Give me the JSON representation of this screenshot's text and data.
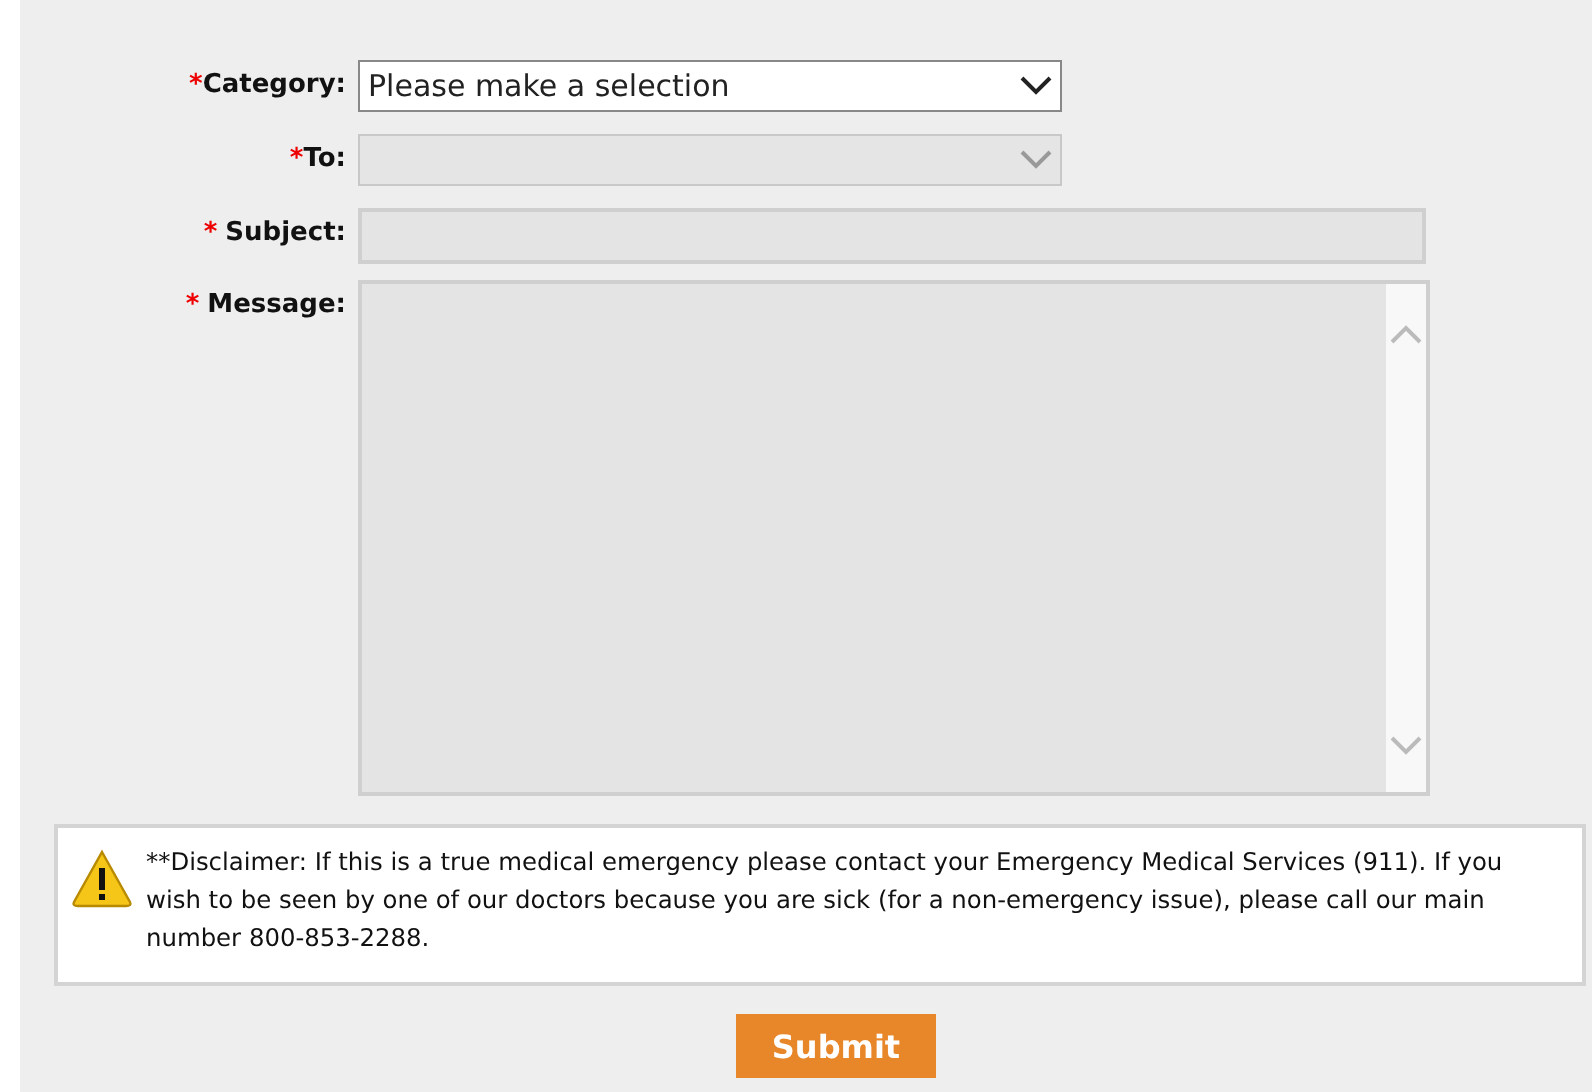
{
  "form": {
    "fields": [
      {
        "kind": "select",
        "mark": "*",
        "spaced": false,
        "label": "Category:",
        "value": "Please make a selection",
        "disabled": false
      },
      {
        "kind": "select",
        "mark": "*",
        "spaced": false,
        "label": "To:",
        "disabled": true
      },
      {
        "kind": "text",
        "mark": "*",
        "spaced": true,
        "label": "Subject:",
        "disabled": true
      },
      {
        "kind": "textarea",
        "mark": "*",
        "spaced": true,
        "label": "Message:",
        "disabled": true
      }
    ]
  },
  "disclaimer": {
    "text": "**Disclaimer: If this is a true medical emergency please contact your Emergency Medical Services (911). If you wish to be seen by one of our doctors because you are sick (for a non-emergency issue), please call our main number 800-853-2288."
  },
  "submit": {
    "label": "Submit"
  }
}
